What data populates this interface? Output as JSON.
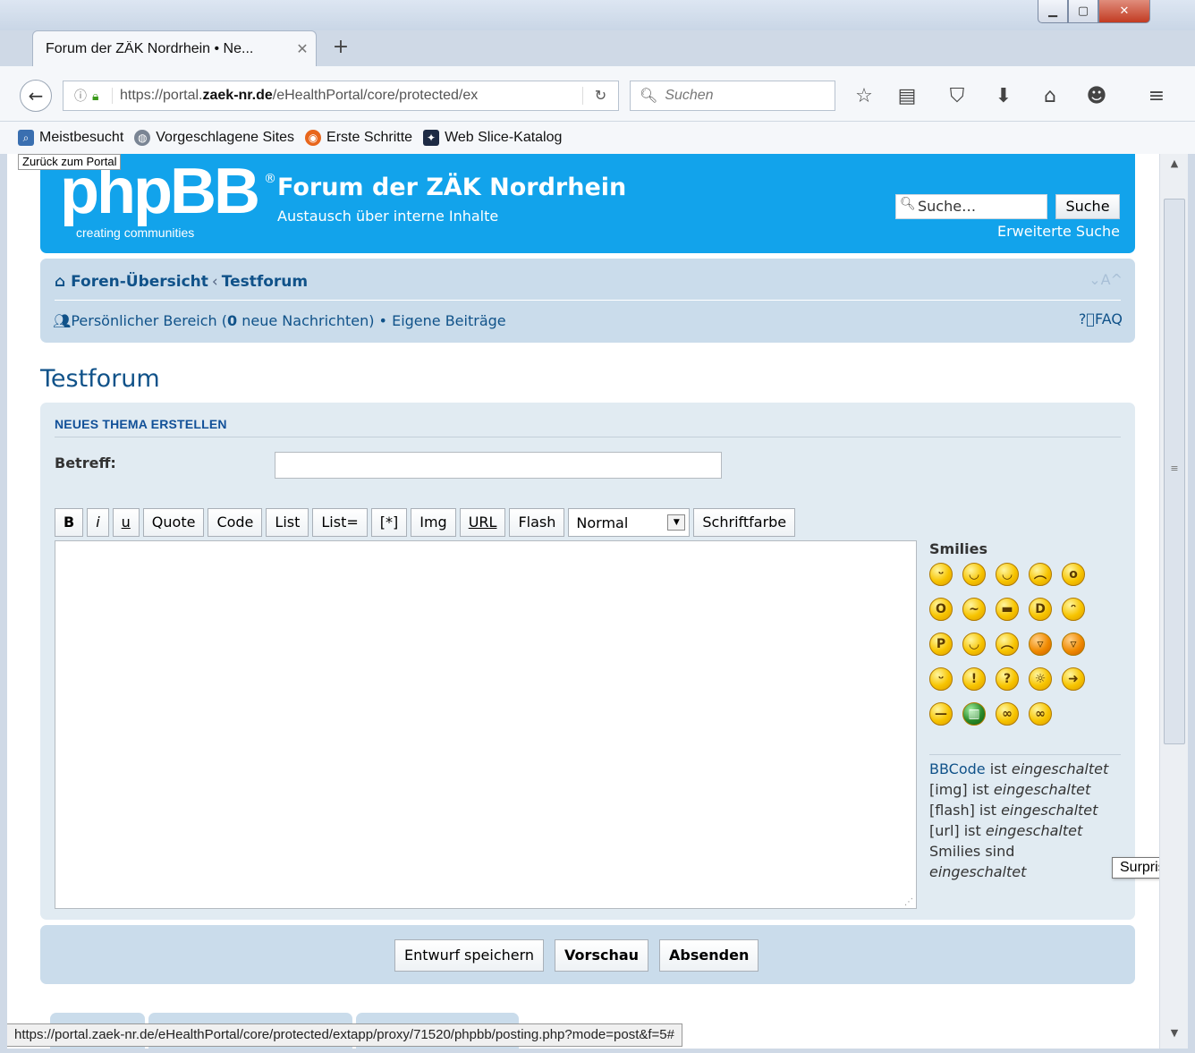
{
  "browser": {
    "tab_title": "Forum der ZÄK Nordrhein • Ne...",
    "url_prefix": "https://portal.",
    "url_domain": "zaek-nr.de",
    "url_rest": "/eHealthPortal/core/protected/ex",
    "search_placeholder": "Suchen",
    "bookmarks": [
      "Meistbesucht",
      "Vorgeschlagene Sites",
      "Erste Schritte",
      "Web Slice-Katalog"
    ],
    "status_url": "https://portal.zaek-nr.de/eHealthPortal/core/protected/extapp/proxy/71520/phpbb/posting.php?mode=post&f=5#"
  },
  "page": {
    "back_to_portal": "Zurück zum Portal",
    "logo_text": "phpBB",
    "logo_reg": "®",
    "logo_tagline": "creating   communities",
    "site_title": "Forum der ZÄK Nordrhein",
    "site_description": "Austausch über interne Inhalte",
    "search_placeholder": "Suche…",
    "search_button": "Suche",
    "advanced_search": "Erweiterte Suche",
    "crumb_home": "Foren-Übersicht",
    "crumb_forum": "Testforum",
    "font_size_toggle": "⌄A^",
    "ucp_label": "Persönlicher Bereich (",
    "ucp_count": "0",
    "ucp_suffix": " neue Nachrichten)",
    "own_posts": "Eigene Beiträge",
    "faq": "FAQ",
    "forum_title": "Testforum"
  },
  "post_form": {
    "heading": "NEUES THEMA ERSTELLEN",
    "subject_label": "Betreff:",
    "subject_value": "",
    "toolbar": {
      "bold": "B",
      "italic": "i",
      "underline": "u",
      "quote": "Quote",
      "code": "Code",
      "list": "List",
      "list_ordered": "List=",
      "list_item": "[*]",
      "img": "Img",
      "url": "URL",
      "flash": "Flash",
      "font_size_selected": "Normal",
      "font_color": "Schriftfarbe"
    },
    "message": "",
    "smilies_heading": "Smilies",
    "smilies_tooltip": "Surprised",
    "bbcode_link": "BBCode",
    "bbcode_status": " ist ",
    "enabled": "eingeschaltet",
    "img_status": "[img] ist ",
    "flash_status": "[flash] ist ",
    "url_status": "[url] ist ",
    "smilies_status": "Smilies sind",
    "save_draft": "Entwurf speichern",
    "preview": "Vorschau",
    "submit": "Absenden"
  }
}
